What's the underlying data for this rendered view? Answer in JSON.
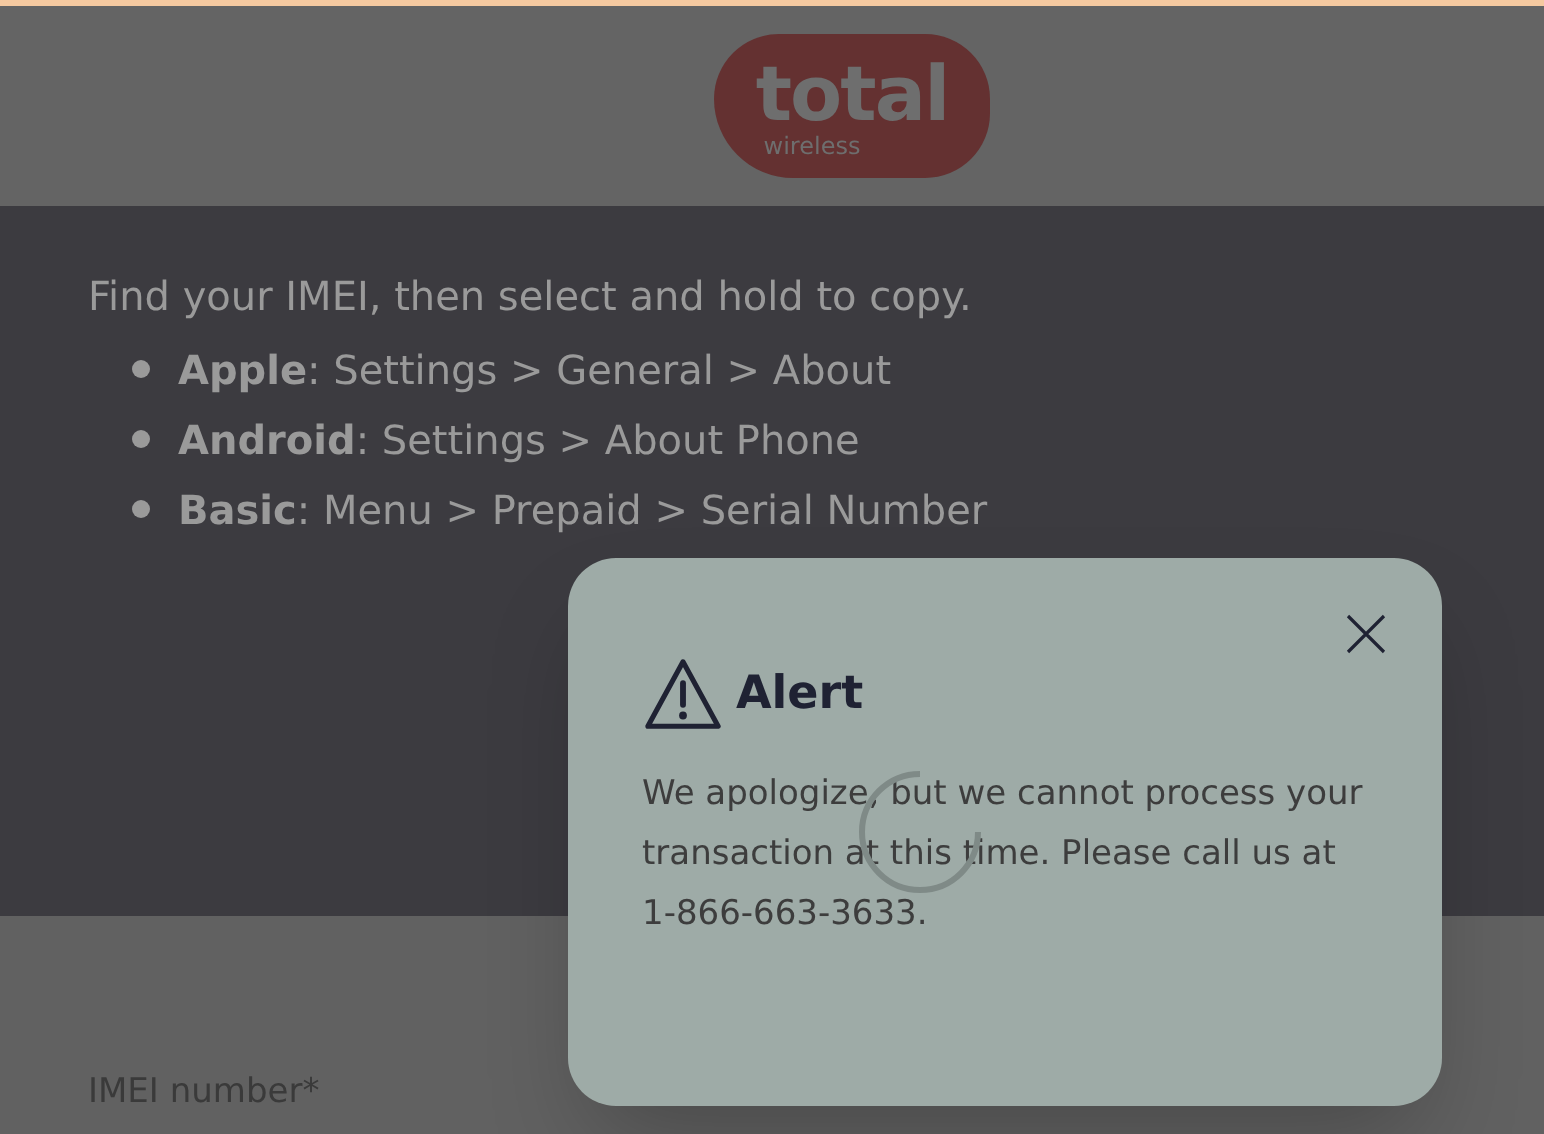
{
  "header": {
    "logo": {
      "brand": "total",
      "tagline": "wireless"
    }
  },
  "intro": {
    "subtitle": "Find your IMEI, then select and hold to copy.",
    "steps": [
      {
        "device": "Apple",
        "path": ": Settings > General > About"
      },
      {
        "device": "Android",
        "path": ": Settings > About Phone"
      },
      {
        "device": "Basic",
        "path": ": Menu > Prepaid > Serial Number"
      }
    ]
  },
  "form": {
    "imei_label": "IMEI number*"
  },
  "alert": {
    "title": "Alert",
    "message": "We apologize, but we cannot process your transaction at this time. Please call us at 1-866-663-3633.",
    "loading": true
  }
}
